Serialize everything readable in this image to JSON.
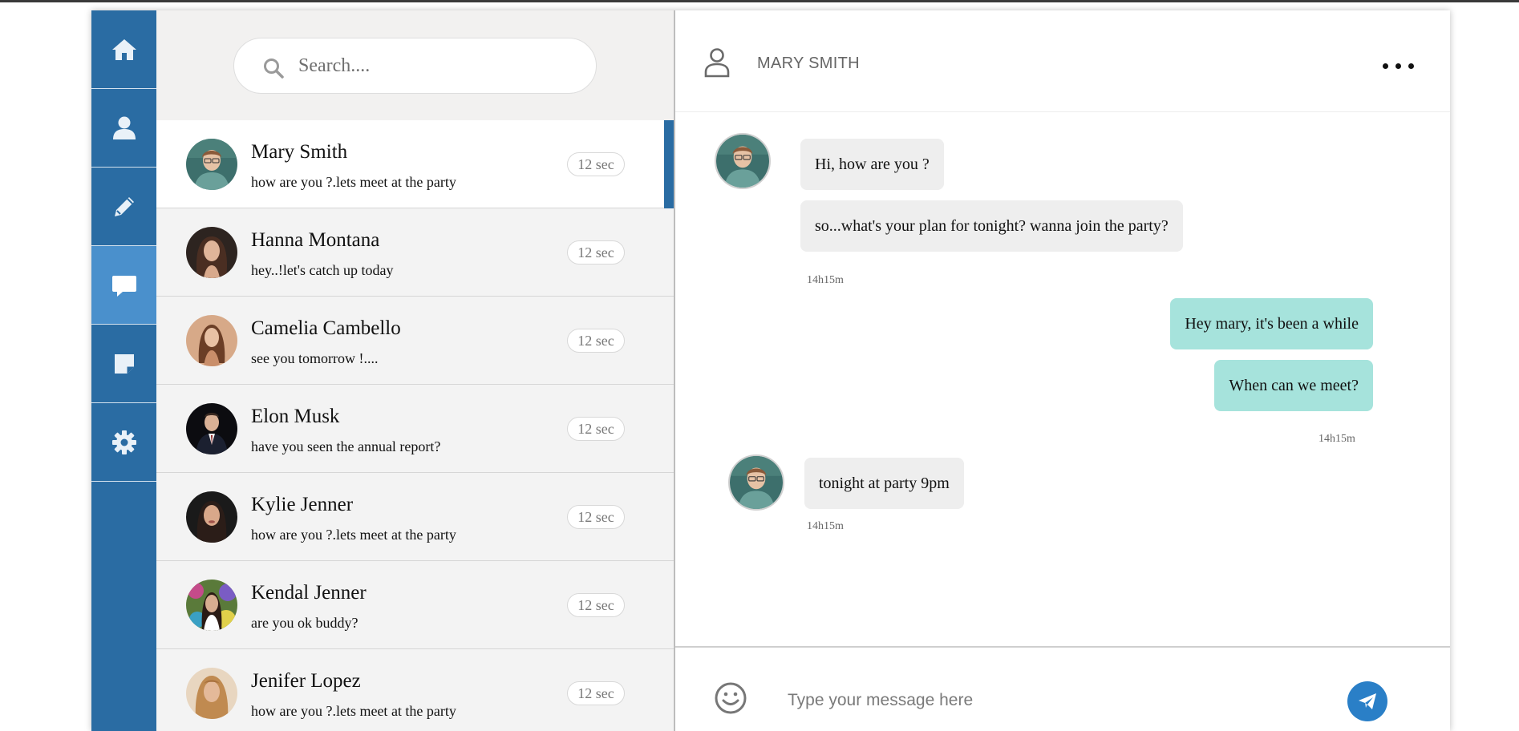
{
  "sidebar": {
    "items": [
      {
        "icon": "home-icon"
      },
      {
        "icon": "user-icon"
      },
      {
        "icon": "pencil-icon"
      },
      {
        "icon": "chat-icon",
        "active": true
      },
      {
        "icon": "note-icon"
      },
      {
        "icon": "gear-icon"
      }
    ]
  },
  "search": {
    "placeholder": "Search...."
  },
  "contacts": [
    {
      "name": "Mary Smith",
      "preview": "how are you ?.lets meet at the party",
      "time": "12 sec",
      "active": true
    },
    {
      "name": "Hanna Montana",
      "preview": "hey..!let's catch up today",
      "time": "12 sec"
    },
    {
      "name": "Camelia Cambello",
      "preview": "see you tomorrow !....",
      "time": "12 sec"
    },
    {
      "name": "Elon Musk",
      "preview": "have you seen the annual report?",
      "time": "12 sec"
    },
    {
      "name": "Kylie Jenner",
      "preview": "how are you ?.lets meet at the party",
      "time": "12 sec"
    },
    {
      "name": "Kendal Jenner",
      "preview": "are you ok buddy?",
      "time": "12 sec"
    },
    {
      "name": "Jenifer Lopez",
      "preview": "how are you ?.lets meet at the party",
      "time": "12 sec"
    }
  ],
  "chat": {
    "title": "MARY SMITH",
    "messages": [
      {
        "text": "Hi, how are you ?",
        "direction": "in"
      },
      {
        "text": "so...what's your plan for tonight? wanna join the party?",
        "direction": "in"
      },
      {
        "text": "Hey mary, it's been a while",
        "direction": "out"
      },
      {
        "text": "When can we meet?",
        "direction": "out"
      },
      {
        "text": "tonight at party 9pm",
        "direction": "in"
      }
    ],
    "timestamps": [
      "14h15m",
      "14h15m",
      "14h15m"
    ],
    "input_placeholder": "Type your message here"
  },
  "colors": {
    "sidebar": "#2a6ca3",
    "sidebar_active": "#4a90cc",
    "outgoing_bubble": "#a6e3dc",
    "incoming_bubble": "#eeeeee",
    "send_button": "#2a7fc7"
  }
}
